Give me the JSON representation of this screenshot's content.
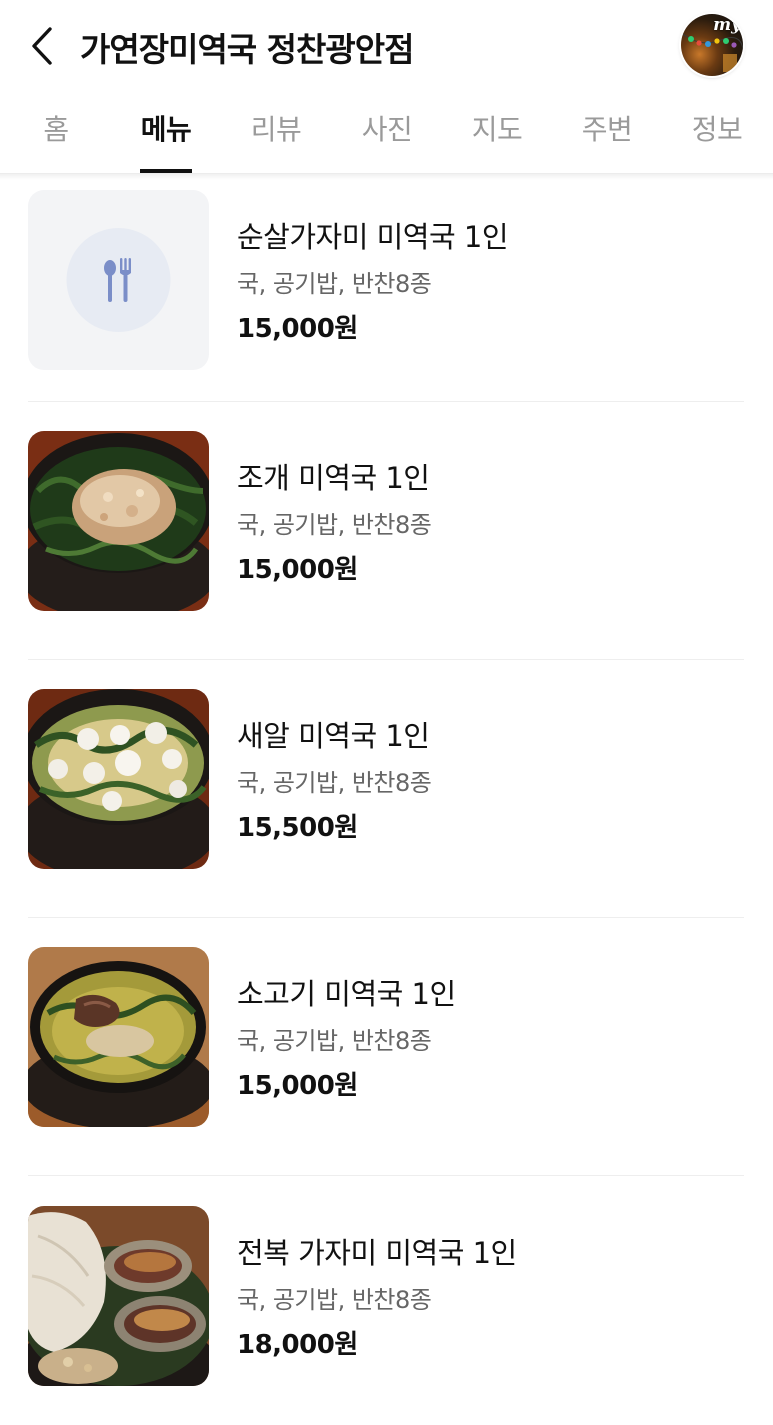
{
  "header": {
    "title": "가연장미역국 정찬광안점",
    "my_label": "my"
  },
  "tabs": [
    {
      "label": "홈",
      "active": false
    },
    {
      "label": "메뉴",
      "active": true
    },
    {
      "label": "리뷰",
      "active": false
    },
    {
      "label": "사진",
      "active": false
    },
    {
      "label": "지도",
      "active": false
    },
    {
      "label": "주변",
      "active": false
    },
    {
      "label": "정보",
      "active": false
    }
  ],
  "menu": [
    {
      "name": "순살가자미 미역국 1인",
      "description": "국, 공기밥, 반찬8종",
      "price": "15,000원",
      "image": "placeholder-utensils-icon"
    },
    {
      "name": "조개 미역국 1인",
      "description": "국, 공기밥, 반찬8종",
      "price": "15,000원",
      "image": "clam-seaweed-soup-photo"
    },
    {
      "name": "새알 미역국 1인",
      "description": "국, 공기밥, 반찬8종",
      "price": "15,500원",
      "image": "rice-ball-seaweed-soup-photo"
    },
    {
      "name": "소고기 미역국 1인",
      "description": "국, 공기밥, 반찬8종",
      "price": "15,000원",
      "image": "beef-seaweed-soup-photo"
    },
    {
      "name": "전복 가자미 미역국 1인",
      "description": "국, 공기밥, 반찬8종",
      "price": "18,000원",
      "image": "abalone-flounder-seaweed-soup-photo"
    }
  ],
  "colors": {
    "text_primary": "#111111",
    "text_secondary": "#666666",
    "tab_inactive": "#9a9a9a",
    "divider": "#eeeeee",
    "placeholder_bg": "#f3f4f6",
    "placeholder_icon": "#7b8ec8"
  }
}
